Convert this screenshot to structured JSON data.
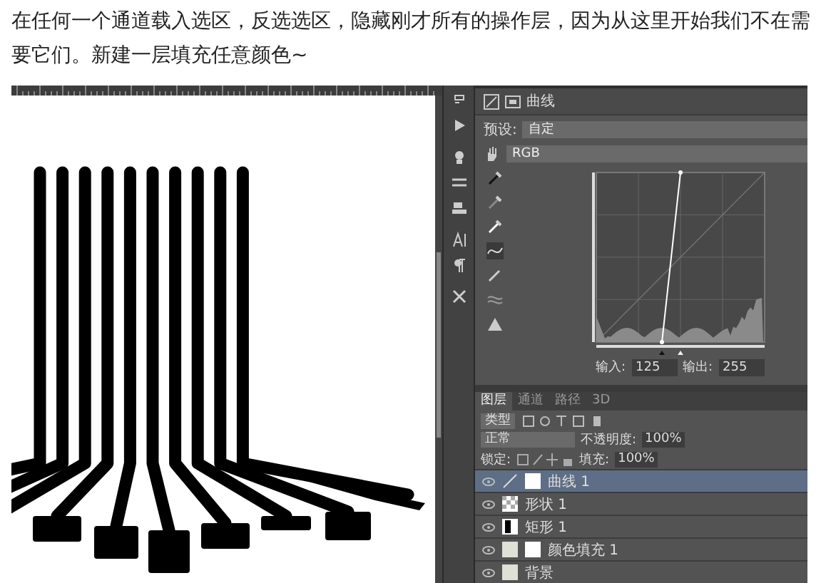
{
  "caption": "在任何一个通道载入选区，反选选区，隐藏刚才所有的操作层，因为从这里开始我们不在需要它们。新建一层填充任意颜色~",
  "properties": {
    "title": "曲线",
    "preset_label": "预设:",
    "preset": "自定",
    "channel": "RGB",
    "input_label": "输入:",
    "input": "125",
    "output_label": "输出:",
    "output": "255"
  },
  "layers_panel": {
    "tabs": [
      {
        "label": "图层",
        "selected": true
      },
      {
        "label": "通道",
        "selected": false
      },
      {
        "label": "路径",
        "selected": false
      },
      {
        "label": "3D",
        "selected": false
      }
    ],
    "filter": "类型",
    "blend_mode": "正常",
    "opacity_label": "不透明度:",
    "opacity": "100%",
    "lock_label": "锁定:",
    "fill_label": "填充:",
    "fill": "100%",
    "layers": [
      {
        "name": "曲线 1",
        "kind": "adjustment",
        "selected": true
      },
      {
        "name": "形状 1",
        "kind": "shape",
        "selected": false
      },
      {
        "name": "矩形 1",
        "kind": "rectangle",
        "selected": false
      },
      {
        "name": "颜色填充 1",
        "kind": "fill",
        "selected": false
      },
      {
        "name": "背景",
        "kind": "background",
        "selected": false
      }
    ]
  }
}
